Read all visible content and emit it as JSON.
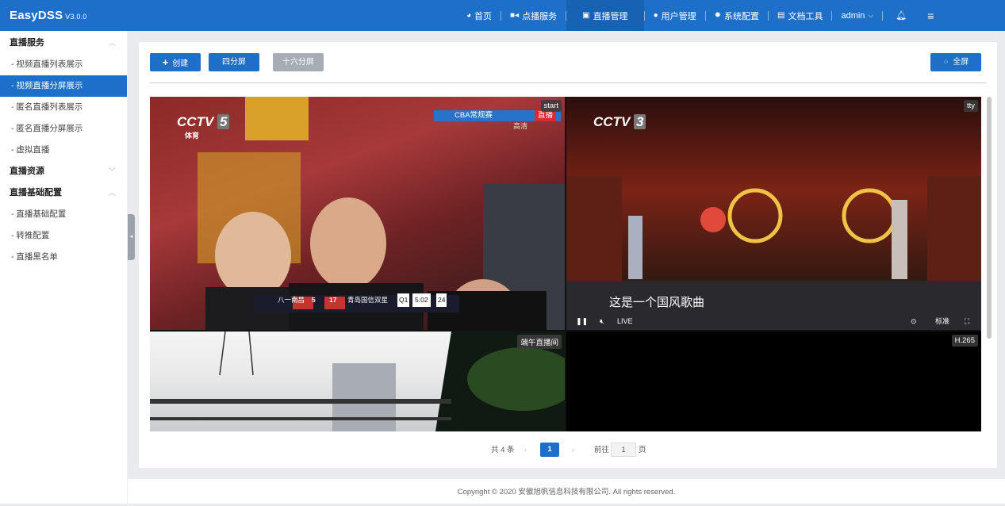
{
  "header": {
    "brand": "EasyDSS",
    "version": "V3.0.0",
    "nav": [
      {
        "label": "首页",
        "icon": "dashboard-icon"
      },
      {
        "label": "点播服务",
        "icon": "video-camera-icon"
      },
      {
        "label": "直播管理",
        "icon": "briefcase-icon"
      },
      {
        "label": "用户管理",
        "icon": "user-icon"
      },
      {
        "label": "系统配置",
        "icon": "gear-icon"
      },
      {
        "label": "文档工具",
        "icon": "document-icon"
      }
    ],
    "user": "admin",
    "colors": {
      "bar": "#1d6fc7",
      "active": "#1862b3"
    }
  },
  "sidebar": {
    "groups": [
      {
        "label": "直播服务",
        "items": [
          "- 视频直播列表展示",
          "- 视频直播分屏展示",
          "- 匿名直播列表展示",
          "- 匿名直播分屏展示",
          "- 虚拟直播"
        ]
      },
      {
        "label": "直播资源",
        "items": []
      },
      {
        "label": "直播基础配置",
        "items": [
          "- 直播基础配置",
          "- 转推配置",
          "- 直播黑名单"
        ]
      }
    ],
    "active_item": "- 视频直播分屏展示"
  },
  "toolbar": {
    "create_label": "创建",
    "four_split_label": "四分屏",
    "sixteen_split_label": "十六分屏",
    "fullscreen_label": "全屏"
  },
  "players": {
    "p1": {
      "tag": "start",
      "channel": "CCTV",
      "channel_num": "5",
      "channel_sub": "体育",
      "banner": "CBA常规赛",
      "banner_badge": "直播",
      "banner_sub": "高清",
      "team_a": "八一南昌",
      "score_a": "5",
      "score_b": "17",
      "team_b": "青岛国信双星",
      "quarter": "Q1",
      "clock": "5:02",
      "shot": "24"
    },
    "p2": {
      "tag": "tty",
      "channel": "CCTV",
      "channel_num": "3",
      "subtitle": "这是一个国风歌曲",
      "live_label": "LIVE",
      "quality_label": "标准"
    },
    "p3": {
      "tag": "端午直播间"
    },
    "p4": {
      "tag": "H.265"
    }
  },
  "pagination": {
    "total_label": "共 4 条",
    "current_page": "1",
    "goto_label": "前往",
    "goto_value": "1",
    "page_unit": "页"
  },
  "footer": {
    "copyright": "Copyright © 2020 安徽旭帆信息科技有限公司. All rights reserved."
  }
}
